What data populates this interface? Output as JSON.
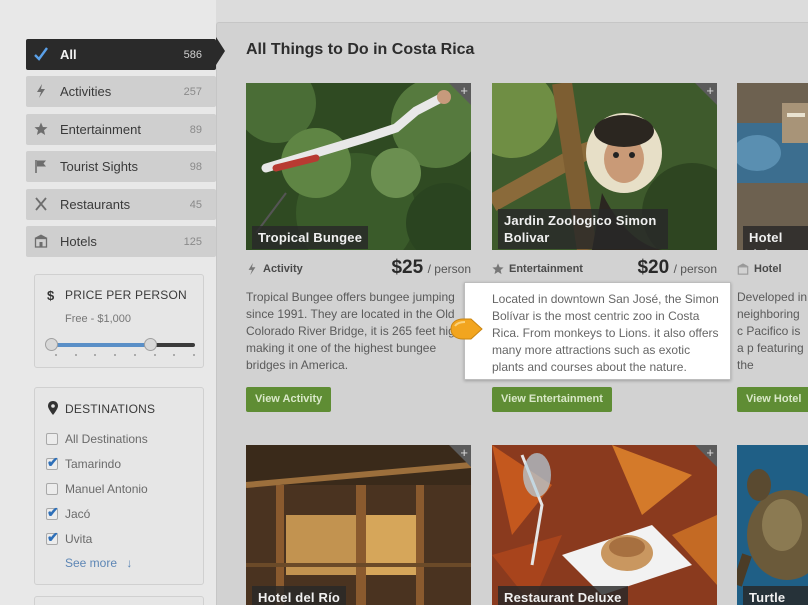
{
  "sidebar": {
    "categories": [
      {
        "label": "All",
        "count": "586",
        "icon": "checkmark-icon",
        "active": true
      },
      {
        "label": "Activities",
        "count": "257",
        "icon": "lightning-icon"
      },
      {
        "label": "Entertainment",
        "count": "89",
        "icon": "star-icon"
      },
      {
        "label": "Tourist Sights",
        "count": "98",
        "icon": "flag-icon"
      },
      {
        "label": "Restaurants",
        "count": "45",
        "icon": "utensils-icon"
      },
      {
        "label": "Hotels",
        "count": "125",
        "icon": "building-icon"
      }
    ],
    "price": {
      "icon": "$",
      "title": "PRICE PER PERSON",
      "range_label": "Free - $1,000",
      "slider_min_fraction": 0.0,
      "slider_max_fraction": 0.69
    },
    "destinations": {
      "title": "DESTINATIONS",
      "items": [
        {
          "label": "All Destinations",
          "checked": false
        },
        {
          "label": "Tamarindo",
          "checked": true
        },
        {
          "label": "Manuel Antonio",
          "checked": false
        },
        {
          "label": "Jacó",
          "checked": true
        },
        {
          "label": "Uvita",
          "checked": true
        }
      ],
      "see_more": "See more",
      "see_more_icon": "↓"
    }
  },
  "main": {
    "title": "All Things to Do in Costa Rica",
    "cards": [
      {
        "name": "Tropical Bungee",
        "type": "Activity",
        "price": "$25",
        "per": "/ person",
        "description": "Tropical Bungee offers bungee jumping since 1991. They are located in the Old Colorado River Bridge, it is 265 feet high making it one of the highest bungee bridges in America.",
        "button": "View Activity"
      },
      {
        "name": "Jardin Zoologico Simon Bolivar",
        "type": "Entertainment",
        "price": "$20",
        "per": "/ person",
        "button": "View Entertainment"
      },
      {
        "name": "Hotel del",
        "type": "Hotel",
        "description": "Developed in neighboring c Pacifico is a p featuring the bewildering n",
        "button": "View Hotel"
      },
      {
        "name": "Hotel del Río"
      },
      {
        "name": "Restaurant Deluxe"
      },
      {
        "name": "Turtle Wa"
      }
    ],
    "tooltip": "Located in downtown San José, the Simon Bolívar is the most centric zoo in Costa Rica. From monkeys to Lions. it also offers many more attractions such as exotic plants and courses about the nature."
  },
  "colors": {
    "active_category_bg": "#2a2a2a",
    "button_green": "#5f8d34",
    "slider_blue": "#5a8fc7",
    "link_blue": "#5d86b5",
    "tooltip_pointer": "#f2a51f"
  }
}
